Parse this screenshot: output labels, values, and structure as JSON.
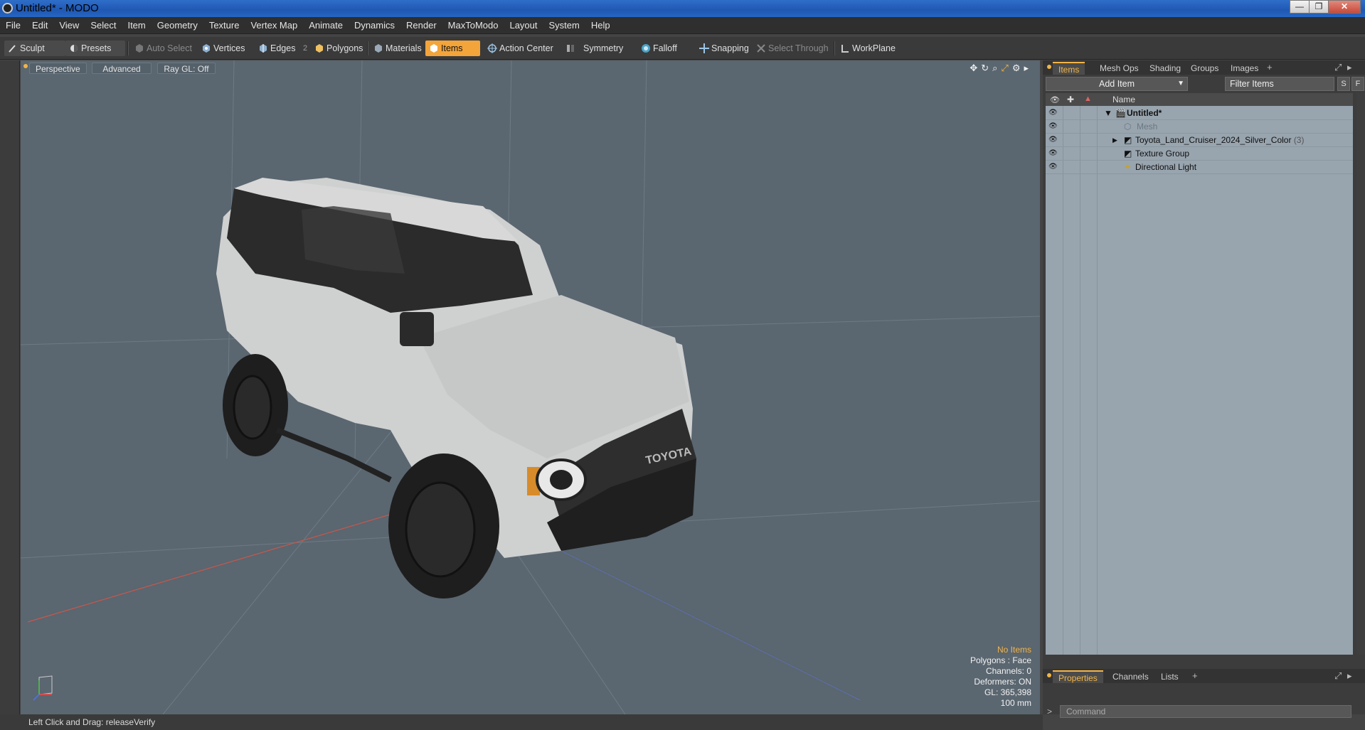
{
  "window": {
    "title": "Untitled* - MODO",
    "minimize": "—",
    "maximize": "❐",
    "close": "✕"
  },
  "menu": [
    "File",
    "Edit",
    "View",
    "Select",
    "Item",
    "Geometry",
    "Texture",
    "Vertex Map",
    "Animate",
    "Dynamics",
    "Render",
    "MaxToModo",
    "Layout",
    "System",
    "Help"
  ],
  "toolbar": {
    "sculpt": "Sculpt",
    "presets": "Presets",
    "auto_select": "Auto Select",
    "vertices": "Vertices",
    "edges": "Edges",
    "edges_count": "2",
    "polygons": "Polygons",
    "materials": "Materials",
    "items": "Items",
    "action_center": "Action Center",
    "symmetry": "Symmetry",
    "falloff": "Falloff",
    "snapping": "Snapping",
    "select_through": "Select Through",
    "workplane": "WorkPlane"
  },
  "viewport": {
    "view": "Perspective",
    "shading": "Advanced",
    "raygl": "Ray GL: Off",
    "hud": {
      "selection": "No Items",
      "polygons": "Polygons : Face",
      "channels": "Channels: 0",
      "deformers": "Deformers: ON",
      "gl": "GL: 365,398",
      "grid": "100 mm"
    },
    "grille_text": "TOYOTA"
  },
  "panel": {
    "tabs": [
      "Items",
      "Mesh Ops",
      "Shading",
      "Groups",
      "Images"
    ],
    "add_item": "Add Item",
    "filter": "Filter Items",
    "s_btn": "S",
    "f_btn": "F",
    "name_header": "Name",
    "rows": [
      {
        "label": "Untitled*",
        "count": ""
      },
      {
        "label": "Mesh",
        "count": ""
      },
      {
        "label": "Toyota_Land_Cruiser_2024_Silver_Color",
        "count": "(3)"
      },
      {
        "label": "Texture Group",
        "count": ""
      },
      {
        "label": "Directional Light",
        "count": ""
      }
    ],
    "bottom_tabs": [
      "Properties",
      "Channels",
      "Lists"
    ],
    "command_placeholder": "Command"
  },
  "status": {
    "text": "Left Click and Drag:  releaseVerify"
  },
  "colors": {
    "accent": "#f2b447",
    "viewport_bg": "#5a6670",
    "tree_bg": "#98a4ae"
  }
}
